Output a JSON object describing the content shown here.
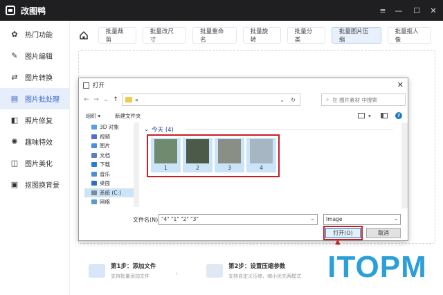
{
  "app": {
    "title": "改图鸭"
  },
  "window_controls": {
    "menu": "≡",
    "minimize": "—",
    "maximize": "☐",
    "close": "✕"
  },
  "sidebar": {
    "items": [
      {
        "label": "热门功能",
        "icon": "hot-icon",
        "glyph": "✿"
      },
      {
        "label": "图片编辑",
        "icon": "edit-icon",
        "glyph": "✎"
      },
      {
        "label": "图片转换",
        "icon": "convert-icon",
        "glyph": "⇄"
      },
      {
        "label": "图片批处理",
        "icon": "batch-icon",
        "glyph": "▤",
        "active": true
      },
      {
        "label": "照片修复",
        "icon": "repair-icon",
        "glyph": "◧"
      },
      {
        "label": "趣味特效",
        "icon": "effects-icon",
        "glyph": "✺"
      },
      {
        "label": "图片美化",
        "icon": "beautify-icon",
        "glyph": "◫"
      },
      {
        "label": "抠图换背景",
        "icon": "cutout-icon",
        "glyph": "▣"
      }
    ]
  },
  "tabs": [
    {
      "label": "批量裁剪"
    },
    {
      "label": "批量改尺寸"
    },
    {
      "label": "批量重命名"
    },
    {
      "label": "批量旋转"
    },
    {
      "label": "批量分类"
    },
    {
      "label": "批量图片压缩",
      "active": true
    },
    {
      "label": "批量抠人像"
    }
  ],
  "steps": [
    {
      "title": "第1步：添加文件",
      "desc": "支持批量添加文件"
    },
    {
      "title": "第2步：设置压缩参数",
      "desc": "支持自定义压缩，缩小优先两模式"
    }
  ],
  "dialog": {
    "title": "打开",
    "address": "«",
    "search_placeholder": "在 图片素材 中搜索",
    "organize": "组织 ▾",
    "new_folder": "新建文件夹",
    "tree": [
      {
        "label": "3D 对象",
        "color": "#5aa0e0"
      },
      {
        "label": "视频",
        "color": "#5a6bd0"
      },
      {
        "label": "图片",
        "color": "#4a90d9"
      },
      {
        "label": "文档",
        "color": "#5a7fc0"
      },
      {
        "label": "下载",
        "color": "#2b7bd9"
      },
      {
        "label": "音乐",
        "color": "#4d8fd8"
      },
      {
        "label": "桌面",
        "color": "#2f6fc0"
      },
      {
        "label": "系统 (C:)",
        "color": "#7a8a9a",
        "selected": true
      },
      {
        "label": "网络",
        "color": "#5a9ad0"
      }
    ],
    "group": "今天 (4)",
    "files": [
      {
        "name": "1",
        "img": "#6f8a6e"
      },
      {
        "name": "2",
        "img": "#4c5a4a"
      },
      {
        "name": "3",
        "img": "#8a8f86"
      },
      {
        "name": "4",
        "img": "#a6b6c2"
      }
    ],
    "filename_label": "文件名(N):",
    "filename_value": "\"4\" \"1\" \"2\" \"3\"",
    "filetype": "Image",
    "open_button": "打开(O)",
    "cancel_button": "取消"
  },
  "watermark": "ITOPM",
  "colors": {
    "accent": "#3a62c8",
    "highlight": "#c81d25",
    "titlebar": "#1f1f22"
  }
}
